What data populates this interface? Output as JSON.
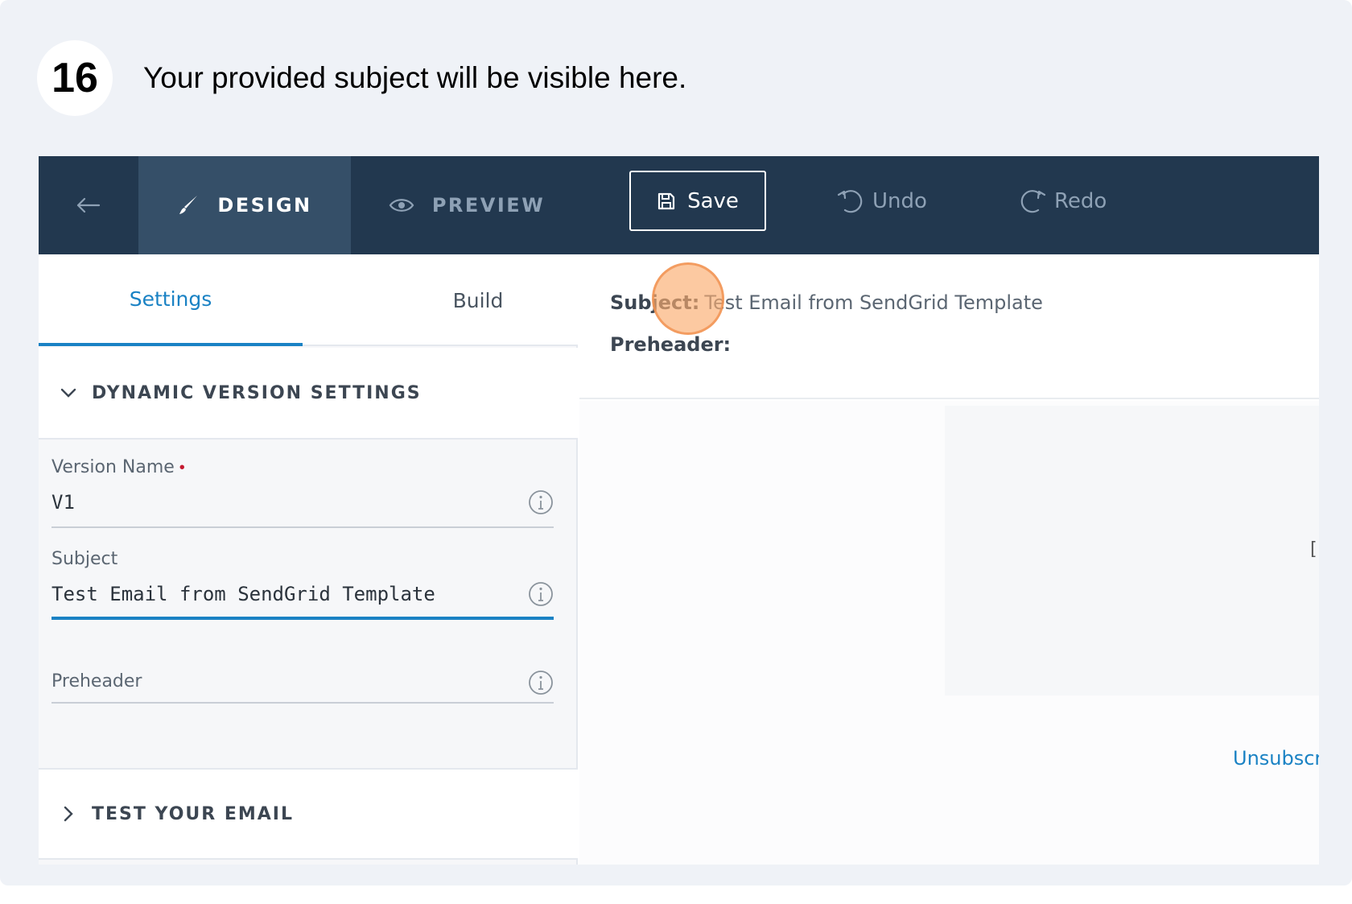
{
  "step": {
    "number": "16",
    "caption": "Your provided subject will be visible here."
  },
  "topbar": {
    "back_icon": "arrow-left-icon",
    "tabs": [
      {
        "label": "DESIGN",
        "icon": "brush-icon",
        "active": true
      },
      {
        "label": "PREVIEW",
        "icon": "eye-icon",
        "active": false
      }
    ],
    "save_label": "Save",
    "undo_label": "Undo",
    "redo_label": "Redo"
  },
  "left_panel": {
    "subtabs": [
      {
        "label": "Settings",
        "active": true
      },
      {
        "label": "Build",
        "active": false
      }
    ],
    "dynamic_section_title": "DYNAMIC VERSION SETTINGS",
    "fields": {
      "version_name": {
        "label": "Version Name",
        "value": "V1",
        "required": true
      },
      "subject": {
        "label": "Subject",
        "value": "Test Email from SendGrid Template"
      },
      "preheader": {
        "label": "Preheader",
        "value": ""
      }
    },
    "test_section_title": "TEST YOUR EMAIL"
  },
  "preview": {
    "subject_key": "Subject:",
    "subject_value": "Test Email from SendGrid Template",
    "preheader_key": "Preheader:",
    "edge_char": "[",
    "unsubscribe_text": "Unsubscri"
  },
  "colors": {
    "topbar": "#22384f",
    "active_tab": "#354f68",
    "accent": "#1a82c4",
    "required": "#c4192f",
    "click_marker": "#faac6e"
  }
}
